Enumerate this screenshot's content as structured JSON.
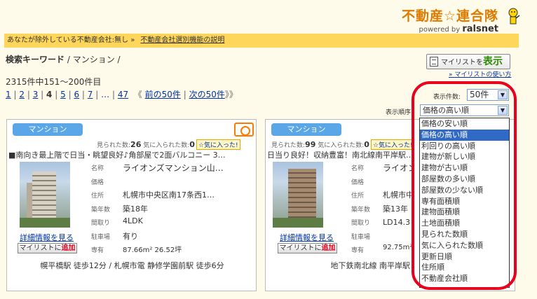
{
  "header": {
    "logo_title": "不動産☆連合隊",
    "logo_powered": "powered by",
    "logo_brand": "ralsnet"
  },
  "notice": {
    "text": "あなたが除外している不動産会社:無し »",
    "link": "不動産会社選別機能の説明"
  },
  "search": {
    "label": "検索キーワード",
    "keyword": "/ マンション /"
  },
  "results": {
    "count_text": "2315件中151～200件目"
  },
  "pagination": {
    "pages": [
      "1",
      "2",
      "3",
      "4",
      "5",
      "6",
      "7"
    ],
    "current": "4",
    "ellipsis": "…",
    "last": "47",
    "prev": "前の50件",
    "next": "次の50件",
    "prev_arrow": "《",
    "next_arrow": "》》"
  },
  "mylist": {
    "button_prefix": "マイリストを",
    "button_action": "表示",
    "howto": "マイリストの使い方"
  },
  "display_count": {
    "label": "表示件数:",
    "value": "50件"
  },
  "sort": {
    "label": "表示順序:",
    "value": "価格の高い順",
    "options": [
      "価格の安い順",
      "価格の高い順",
      "利回りの高い順",
      "建物が新しい順",
      "建物が古い順",
      "部屋数の多い順",
      "部屋数の少ない順",
      "専有面積順",
      "建物面積順",
      "土地面積順",
      "見られた数順",
      "気に入られた数順",
      "更新日順",
      "住所順",
      "不動産会社順"
    ],
    "selected_index": 1
  },
  "listings": [
    {
      "tag": "マンション",
      "views_label": "見られた数:",
      "views": "26",
      "favs_label": "気に入られた数:",
      "favs": "0",
      "fav_button": "気に入った!",
      "description": "■南向き最上階で日当・眺望良好♪角部屋で2面バルコニー 3…",
      "detail_link": "詳細情報を見る",
      "add_prefix": "マイリストに",
      "add_action": "追加",
      "fields": [
        {
          "k": "名称",
          "v": "ライオンズマンション山…"
        },
        {
          "k": "価格",
          "v": ""
        },
        {
          "k": "住所",
          "v": "札幌市中央区南17条西1…"
        },
        {
          "k": "築年数",
          "v": "築18年"
        },
        {
          "k": "間取り",
          "v": "4LDK"
        },
        {
          "k": "駐車場",
          "v": "有り"
        },
        {
          "k": "専有",
          "v": "87.66m² 26.52坪"
        }
      ],
      "access": "幌平橋駅 徒歩12分 / 札幌市電 静修学園前駅 徒歩6分"
    },
    {
      "tag": "マンション",
      "views_label": "見られた数:",
      "views": "99",
      "favs_label": "気に入られた数:",
      "favs": "0",
      "fav_button": "気に入った!",
      "description": "日当り良好！収納豊富！南北線南平岸駅…",
      "detail_link": "詳細情報を見る",
      "add_prefix": "マイリストに",
      "add_action": "追加",
      "fields": [
        {
          "k": "名称",
          "v": "ライオンズ…"
        },
        {
          "k": "価格",
          "v": ""
        },
        {
          "k": "住所",
          "v": "札幌市中央…"
        },
        {
          "k": "築年数",
          "v": "築13年"
        },
        {
          "k": "間取り",
          "v": "LD14.3・…"
        },
        {
          "k": "駐車場",
          "v": ""
        },
        {
          "k": "専有",
          "v": "92.75m² 28…"
        }
      ],
      "access": "地下鉄南北線 南平岸駅"
    }
  ]
}
